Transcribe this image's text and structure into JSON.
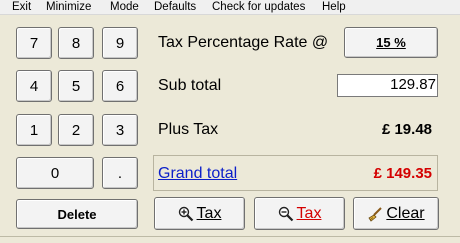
{
  "menu": [
    "Exit",
    "Minimize",
    "Mode",
    "Defaults",
    "Check for updates",
    "Help"
  ],
  "keypad": {
    "row1": [
      "7",
      "8",
      "9"
    ],
    "row2": [
      "4",
      "5",
      "6"
    ],
    "row3": [
      "1",
      "2",
      "3"
    ],
    "zero": "0",
    "dot": ".",
    "delete": "Delete"
  },
  "tax_rate": {
    "label": "Tax Percentage Rate  @",
    "button": "15 %"
  },
  "subtotal": {
    "label": "Sub total",
    "value": "129.87"
  },
  "plus_tax": {
    "label": "Plus Tax",
    "value": "£ 19.48"
  },
  "grand_total": {
    "label": "Grand total",
    "value": "£ 149.35",
    "value_color": "#d40000"
  },
  "actions": {
    "add_tax": {
      "label": "Tax",
      "icon": "zoom-in-icon"
    },
    "remove_tax": {
      "label": "Tax",
      "icon": "zoom-out-icon",
      "color": "#d40000"
    },
    "clear": {
      "label": "Clear",
      "icon": "broom-icon"
    }
  }
}
